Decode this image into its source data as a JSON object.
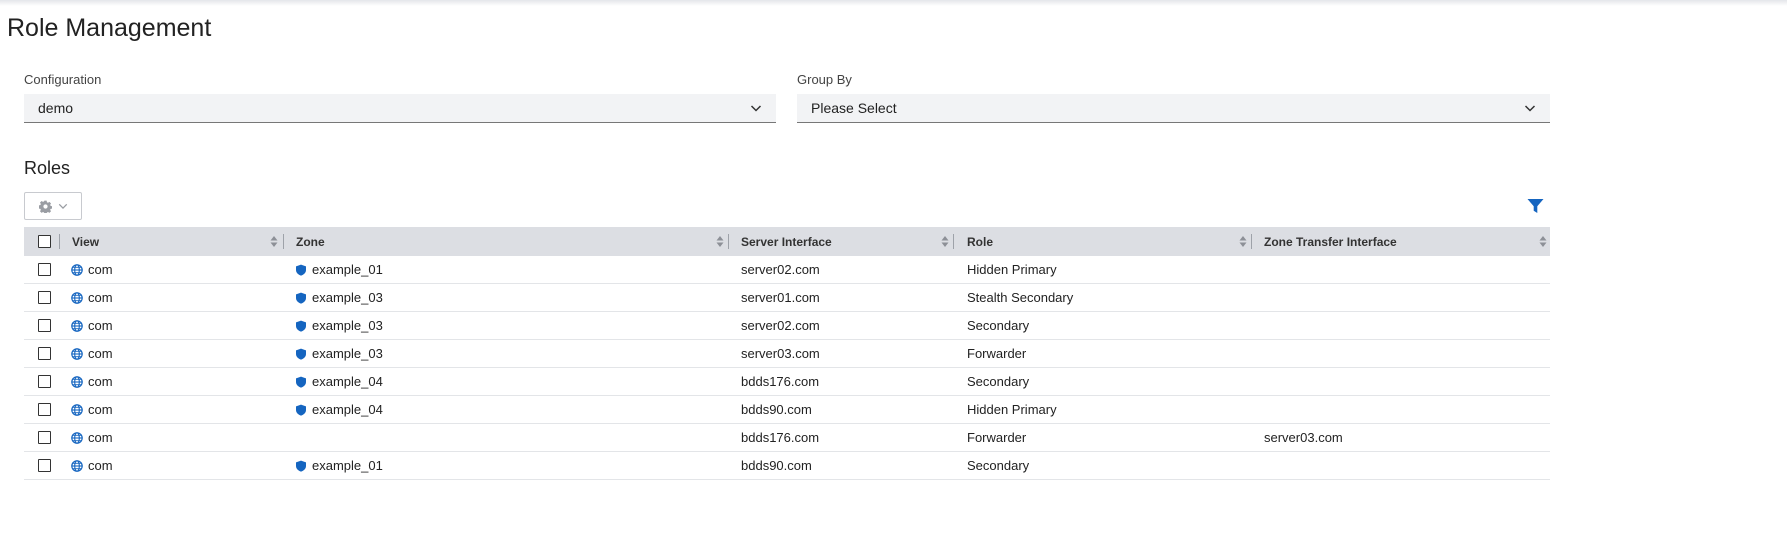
{
  "page": {
    "title": "Role Management"
  },
  "filters": {
    "configuration": {
      "label": "Configuration",
      "value": "demo"
    },
    "group_by": {
      "label": "Group By",
      "value": "Please Select"
    }
  },
  "roles": {
    "title": "Roles",
    "columns": [
      "View",
      "Zone",
      "Server Interface",
      "Role",
      "Zone Transfer Interface"
    ],
    "rows": [
      {
        "view": "com",
        "zone": "example_01",
        "server": "server02.com",
        "role": "Hidden Primary",
        "transfer": ""
      },
      {
        "view": "com",
        "zone": "example_03",
        "server": "server01.com",
        "role": "Stealth Secondary",
        "transfer": ""
      },
      {
        "view": "com",
        "zone": "example_03",
        "server": "server02.com",
        "role": "Secondary",
        "transfer": ""
      },
      {
        "view": "com",
        "zone": "example_03",
        "server": "server03.com",
        "role": "Forwarder",
        "transfer": ""
      },
      {
        "view": "com",
        "zone": "example_04",
        "server": "bdds176.com",
        "role": "Secondary",
        "transfer": ""
      },
      {
        "view": "com",
        "zone": "example_04",
        "server": "bdds90.com",
        "role": "Hidden Primary",
        "transfer": ""
      },
      {
        "view": "com",
        "zone": "",
        "server": "bdds176.com",
        "role": "Forwarder",
        "transfer": "server03.com"
      },
      {
        "view": "com",
        "zone": "example_01",
        "server": "bdds90.com",
        "role": "Secondary",
        "transfer": ""
      }
    ]
  },
  "icons": {
    "view_icon": "globe-icon",
    "zone_icon": "shield-icon",
    "settings_icon": "gear-icon",
    "filter_icon": "filter-icon",
    "dropdown_icon": "chevron-down-icon"
  },
  "colors": {
    "accent": "#1565c0",
    "header_bg": "#dcdee3",
    "select_bg": "#f2f3f5"
  }
}
